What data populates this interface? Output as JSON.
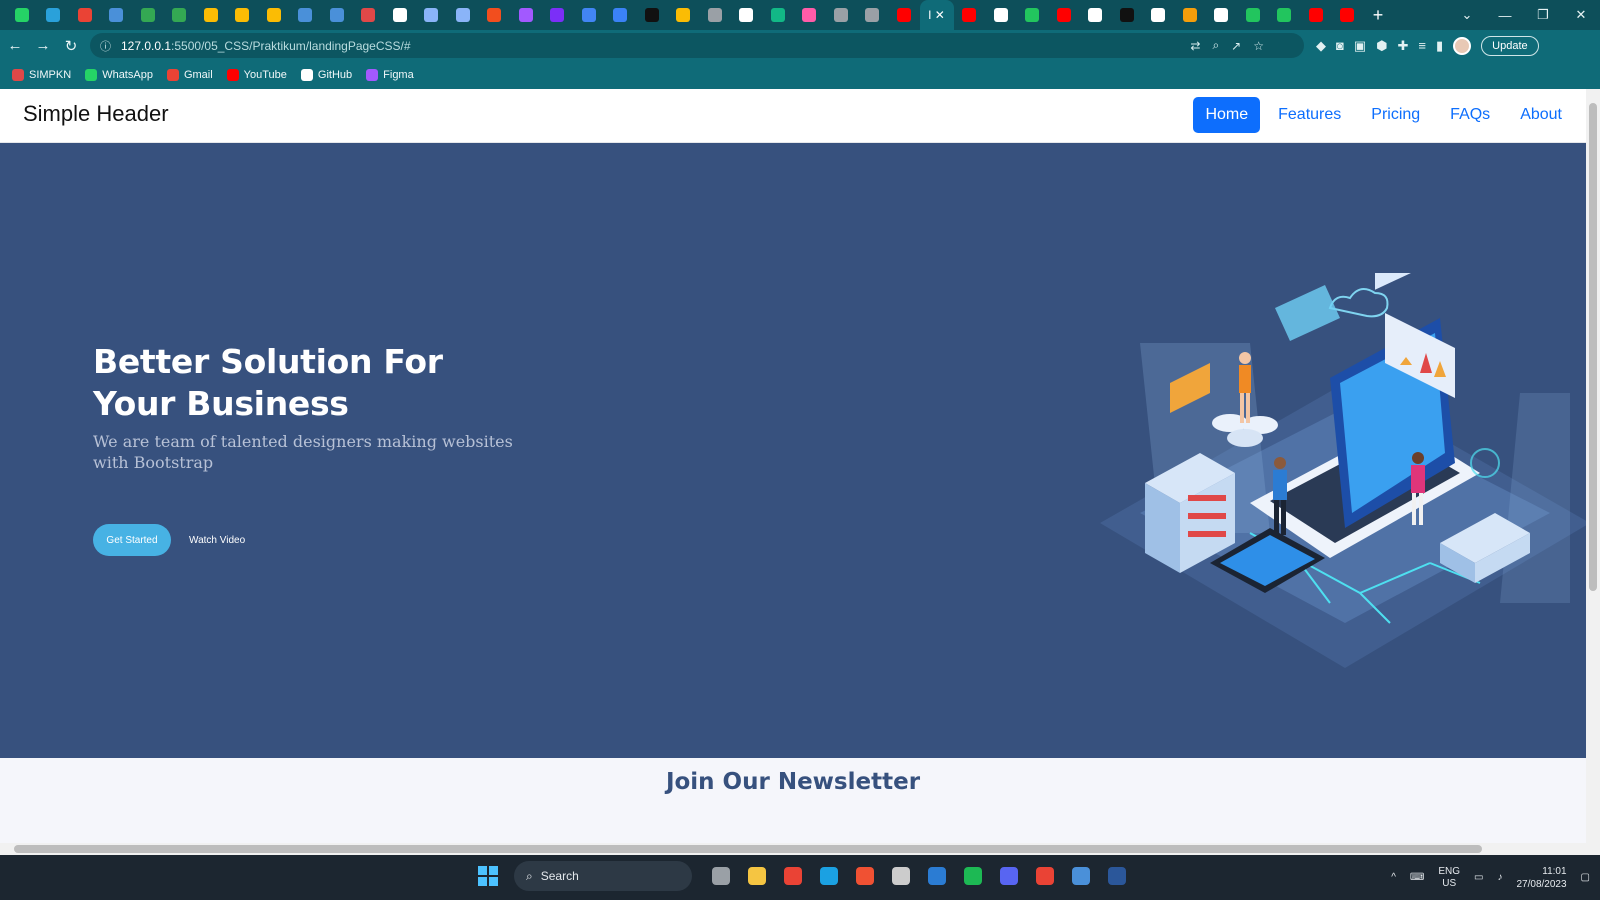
{
  "browser": {
    "tabs": {
      "favicon_colors": [
        "#25d366",
        "#2aa1da",
        "#ea4335",
        "#4a90d9",
        "#34a853",
        "#34a853",
        "#fbbc04",
        "#fbbc04",
        "#fbbc04",
        "#4a90d9",
        "#4a90d9",
        "#e04848",
        "#ffffff",
        "#8ab4f8",
        "#8ab4f8",
        "#f24e1e",
        "#a259ff",
        "#7b2ff7",
        "#4285f4",
        "#3b82f6",
        "#111111",
        "#fbbc04",
        "#9aa0a6",
        "#ffffff",
        "#12b886",
        "#ff5ca8",
        "#9aa0a6",
        "#9aa0a6",
        "#ff0000"
      ],
      "active_label": "I",
      "more_favicon_colors": [
        "#ff0000",
        "#ffffff",
        "#22c55e",
        "#ff0000",
        "#ffffff",
        "#111111",
        "#ffffff",
        "#f59e0b",
        "#ffffff",
        "#22c55e",
        "#22c55e",
        "#ff0000",
        "#ff0000"
      ],
      "new_tab_label": "+"
    },
    "window_controls": {
      "dropdown": "⌄",
      "minimize": "—",
      "restore": "❐",
      "close": "✕"
    },
    "nav": {
      "back": "←",
      "forward": "→",
      "reload": "↻"
    },
    "address": {
      "info_icon": "ⓘ",
      "host": "127.0.0.1",
      "path": ":5500/05_CSS/Praktikum/landingPageCSS/#"
    },
    "omnibox_icons": [
      "translate-icon",
      "zoom-icon",
      "share-icon",
      "star-icon"
    ],
    "update_label": "Update",
    "bookmarks": [
      {
        "label": "SIMPKN",
        "color": "#e04848"
      },
      {
        "label": "WhatsApp",
        "color": "#25d366"
      },
      {
        "label": "Gmail",
        "color": "#ea4335"
      },
      {
        "label": "YouTube",
        "color": "#ff0000"
      },
      {
        "label": "GitHub",
        "color": "#ffffff"
      },
      {
        "label": "Figma",
        "color": "#a259ff"
      }
    ]
  },
  "page": {
    "brand": "Simple Header",
    "nav": [
      {
        "label": "Home",
        "active": true
      },
      {
        "label": "Features"
      },
      {
        "label": "Pricing"
      },
      {
        "label": "FAQs"
      },
      {
        "label": "About"
      }
    ],
    "hero": {
      "title": "Better Solution For Your Business",
      "subtitle": "We are team of talented designers making websites with Bootstrap",
      "primary_button": "Get Started",
      "secondary_button": "Watch Video",
      "background": "#37517e",
      "accent": "#47b2e4"
    },
    "newsletter_title": "Join Our Newsletter"
  },
  "taskbar": {
    "search_placeholder": "Search",
    "app_colors": [
      "#9aa0a6",
      "#f5c542",
      "#ea4335",
      "#1ba1e2",
      "#f05133",
      "#cccccc",
      "#2b7cd3",
      "#1db954",
      "#5865f2",
      "#ea4335",
      "#4a90d9",
      "#2b579a"
    ],
    "tray": {
      "chevron": "^",
      "lang_top": "ENG",
      "lang_bottom": "US",
      "time": "11:01",
      "date": "27/08/2023"
    }
  }
}
